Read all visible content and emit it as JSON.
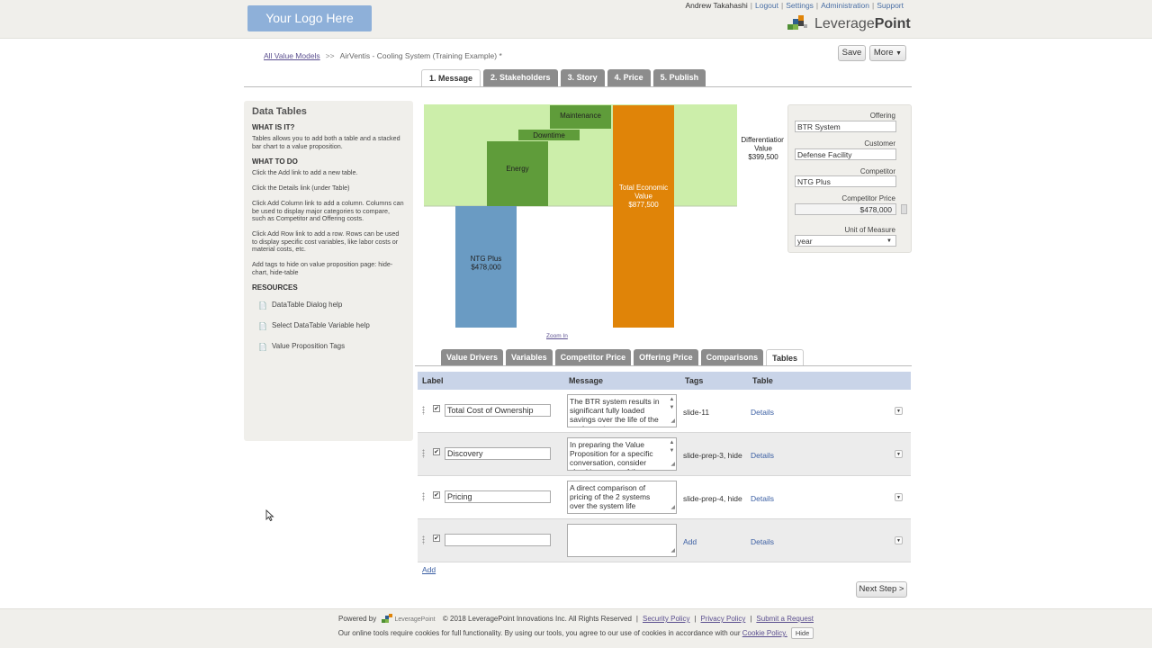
{
  "header": {
    "logo_text": "Your Logo Here",
    "user_name": "Andrew Takahashi",
    "links": [
      "Logout",
      "Settings",
      "Administration",
      "Support"
    ],
    "brand_light": "Leverage",
    "brand_bold": "Point"
  },
  "breadcrumb": {
    "root": "All Value Models",
    "separator": ">>",
    "current": "AirVentis - Cooling System (Training Example) *"
  },
  "toolbar": {
    "save_label": "Save",
    "more_label": "More"
  },
  "steps": [
    {
      "label": "1. Message",
      "active": true
    },
    {
      "label": "2. Stakeholders",
      "active": false
    },
    {
      "label": "3. Story",
      "active": false
    },
    {
      "label": "4. Price",
      "active": false
    },
    {
      "label": "5. Publish",
      "active": false
    }
  ],
  "help": {
    "title": "Data Tables",
    "what_heading": "WHAT IS IT?",
    "what_text": "Tables allows you to add both a table and a stacked bar chart to a value proposition.",
    "todo_heading": "WHAT TO DO",
    "todo_1": "Click the Add link to add a new table.",
    "todo_2": "Click the Details link (under Table)",
    "todo_3": "Click Add Column link to add a column. Columns can be used to display major categories to compare, such as Competitor and Offering costs.",
    "todo_4": "Click Add Row link to add a row. Rows can be used to display specific cost variables, like labor costs or material costs, etc.",
    "todo_5": "Add tags to hide on value proposition page: hide-chart, hide-table",
    "resources_heading": "RESOURCES",
    "resources": [
      "DataTable Dialog help",
      "Select DataTable Variable help",
      "Value Proposition Tags"
    ]
  },
  "chart_data": {
    "type": "bar",
    "subtype": "waterfall",
    "bars": [
      {
        "label": "NTG Plus",
        "value_label": "$478,000",
        "value": 478000,
        "color": "#6a9bc3"
      },
      {
        "label": "Energy",
        "color": "#5f9c3a"
      },
      {
        "label": "Downtime",
        "color": "#5f9c3a"
      },
      {
        "label": "Maintenance",
        "color": "#5f9c3a"
      },
      {
        "label": "Total Economic Value",
        "value_label": "$877,500",
        "value": 877500,
        "color": "#e08408"
      }
    ],
    "band_color": "#cceeaa",
    "differentiation_label": "Differentiation Value",
    "differentiation_value": "$399,500",
    "zoom_label": "Zoom In"
  },
  "offering_panel": {
    "offering_label": "Offering",
    "offering_value": "BTR System",
    "customer_label": "Customer",
    "customer_value": "Defense Facility",
    "competitor_label": "Competitor",
    "competitor_value": "NTG Plus",
    "competitor_price_label": "Competitor Price",
    "competitor_price_value": "$478,000",
    "unit_label": "Unit of Measure",
    "unit_value": "year"
  },
  "subtabs": [
    {
      "label": "Value Drivers",
      "active": false
    },
    {
      "label": "Variables",
      "active": false
    },
    {
      "label": "Competitor Price",
      "active": false
    },
    {
      "label": "Offering Price",
      "active": false
    },
    {
      "label": "Comparisons",
      "active": false
    },
    {
      "label": "Tables",
      "active": true
    }
  ],
  "table": {
    "columns": [
      "Label",
      "Message",
      "Tags",
      "Table"
    ],
    "rows": [
      {
        "label": "Total Cost of Ownership",
        "message": "The BTR system results in significant fully loaded savings over the life of the equipment",
        "tags": "slide-11",
        "table_link": "Details"
      },
      {
        "label": "Discovery",
        "message": "In preparing the Value Proposition for a specific conversation, consider checking some of these",
        "tags": "slide-prep-3, hide",
        "table_link": "Details"
      },
      {
        "label": "Pricing",
        "message": "A direct comparison of pricing of the 2 systems over the system life",
        "tags": "slide-prep-4, hide",
        "table_link": "Details"
      },
      {
        "label": "",
        "message": "",
        "tags": "Add",
        "table_link": "Details"
      }
    ],
    "add_link": "Add"
  },
  "next_button": "Next Step >",
  "footer": {
    "powered_by": "Powered by",
    "brand": "LeveragePoint",
    "copyright": "© 2018 LeveragePoint Innovations Inc. All Rights Reserved",
    "links": [
      "Security Policy",
      "Privacy Policy",
      "Submit a Request"
    ],
    "cookie_text": "Our online tools require cookies for full functionality. By using our tools, you agree to our use of cookies in accordance with our",
    "cookie_link": "Cookie Policy.",
    "hide_label": "Hide"
  }
}
